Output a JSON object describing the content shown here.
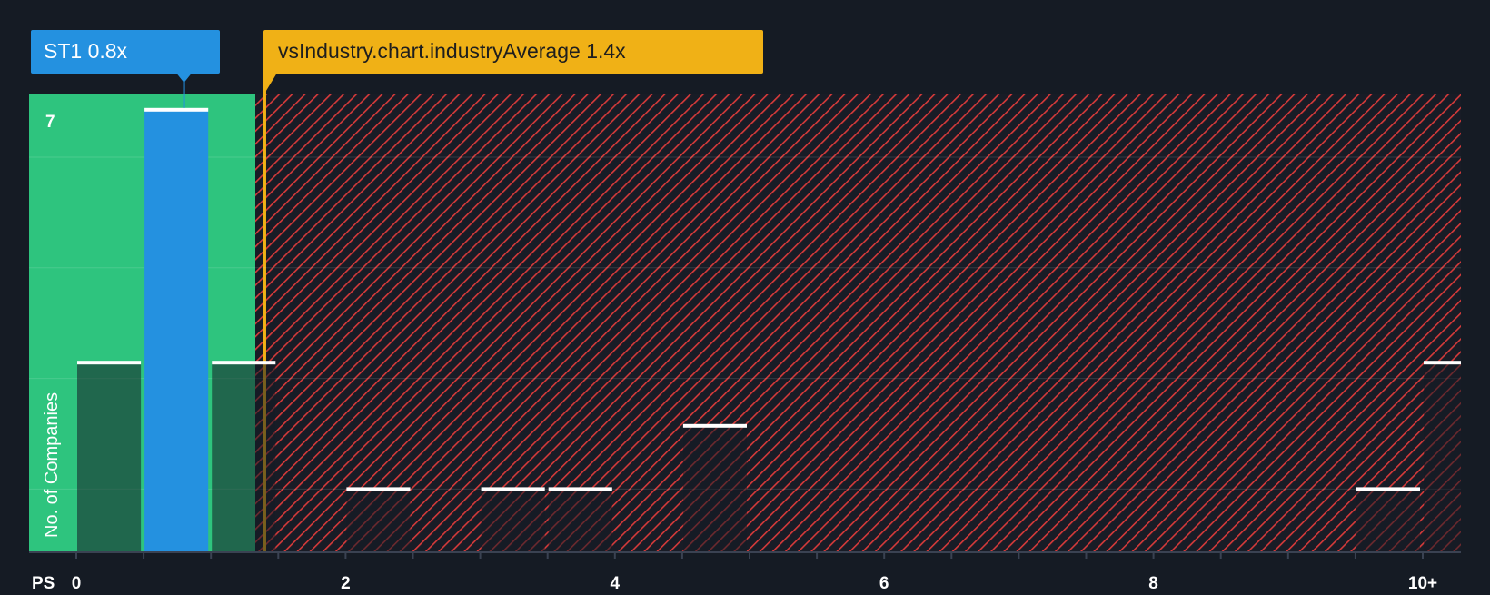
{
  "colors": {
    "background": "#151b24",
    "below_zone": "#2ec47e",
    "above_zone_hatch": "#e0403f",
    "company_bar": "#2491e0",
    "industry_marker": "#f0b116",
    "bar_cap": "#ffffff"
  },
  "callouts": {
    "company": "ST1 0.8x",
    "industry": "vsIndustry.chart.industryAverage 1.4x"
  },
  "chart_data": {
    "type": "bar",
    "xlabel": "PS",
    "ylabel": "No. of Companies",
    "x_ticks": [
      "0",
      "2",
      "4",
      "6",
      "8",
      "10+"
    ],
    "y_tick_labels": [
      "7"
    ],
    "xlim": [
      0,
      10.25
    ],
    "ylim": [
      0,
      7.25
    ],
    "bin_width": 0.5,
    "company": {
      "ticker": "ST1",
      "ps": 0.8
    },
    "industry_average_ps": 1.4,
    "bins": [
      {
        "start": 0.0,
        "count": 3,
        "highlight": false
      },
      {
        "start": 0.5,
        "count": 7,
        "highlight": true
      },
      {
        "start": 1.0,
        "count": 3,
        "highlight": false
      },
      {
        "start": 2.0,
        "count": 1,
        "highlight": false
      },
      {
        "start": 3.0,
        "count": 1,
        "highlight": false
      },
      {
        "start": 3.5,
        "count": 1,
        "highlight": false
      },
      {
        "start": 4.5,
        "count": 2,
        "highlight": false
      },
      {
        "start": 9.5,
        "count": 1,
        "highlight": false
      },
      {
        "start": 10.0,
        "count": 3,
        "highlight": false
      }
    ],
    "grid": true
  }
}
